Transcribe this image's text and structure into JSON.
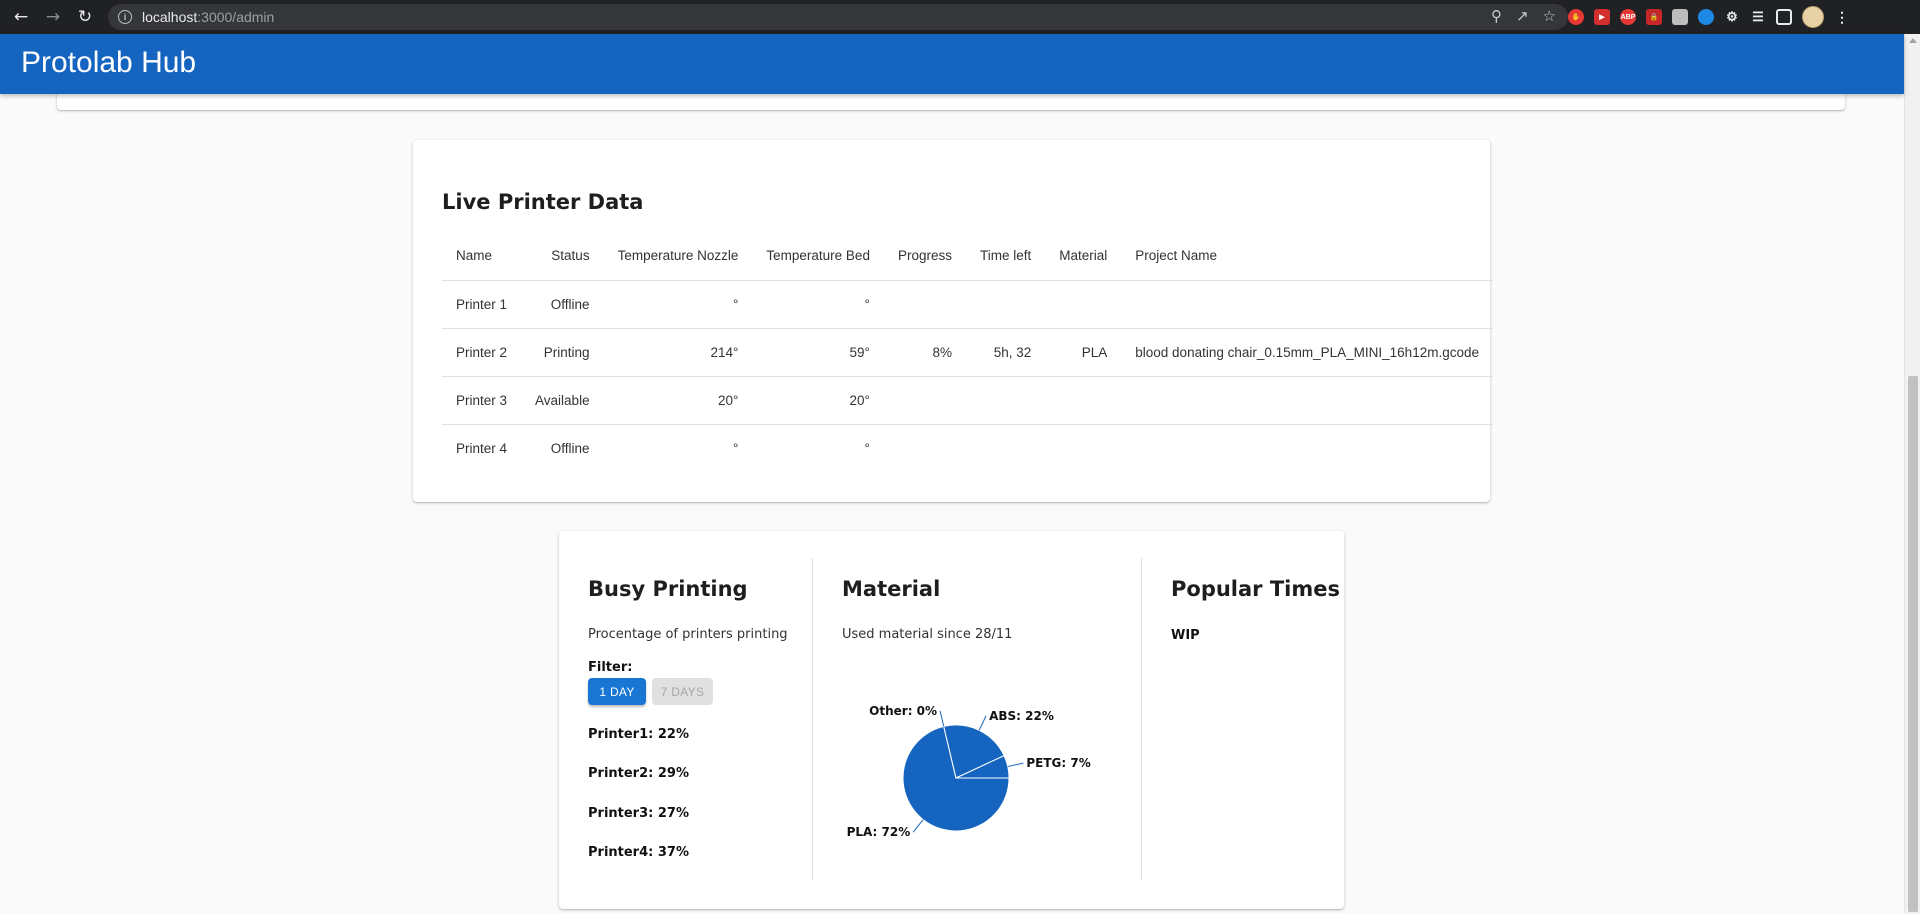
{
  "browser": {
    "url_host": "localhost",
    "url_rest": ":3000/admin"
  },
  "app": {
    "title": "Protolab Hub"
  },
  "live": {
    "title": "Live Printer Data",
    "columns": [
      "Name",
      "Status",
      "Temperature Nozzle",
      "Temperature Bed",
      "Progress",
      "Time left",
      "Material",
      "Project Name"
    ],
    "rows": [
      {
        "name": "Printer 1",
        "status": "Offline",
        "nozzle": "°",
        "bed": "°",
        "progress": "",
        "time_left": "",
        "material": "",
        "project": ""
      },
      {
        "name": "Printer 2",
        "status": "Printing",
        "nozzle": "214°",
        "bed": "59°",
        "progress": "8%",
        "time_left": "5h, 32",
        "material": "PLA",
        "project": "blood donating chair_0.15mm_PLA_MINI_16h12m.gcode"
      },
      {
        "name": "Printer 3",
        "status": "Available",
        "nozzle": "20°",
        "bed": "20°",
        "progress": "",
        "time_left": "",
        "material": "",
        "project": ""
      },
      {
        "name": "Printer 4",
        "status": "Offline",
        "nozzle": "°",
        "bed": "°",
        "progress": "",
        "time_left": "",
        "material": "",
        "project": ""
      }
    ]
  },
  "busy": {
    "title": "Busy Printing",
    "subtitle": "Procentage of printers printing",
    "filter_label": "Filter:",
    "btn_1day": "1 DAY",
    "btn_7days": "7 DAYS",
    "stats": [
      "Printer1: 22%",
      "Printer2: 29%",
      "Printer3: 27%",
      "Printer4: 37%"
    ]
  },
  "material": {
    "title": "Material",
    "subtitle": "Used material since 28/11",
    "color": "#1565c0"
  },
  "popular": {
    "title": "Popular Times",
    "wip": "WIP"
  },
  "chart_data": {
    "type": "pie",
    "slices": [
      {
        "label": "PLA: 72%",
        "value": 72
      },
      {
        "label": "Other: 0%",
        "value": 0
      },
      {
        "label": "ABS: 22%",
        "value": 22
      },
      {
        "label": "PETG: 7%",
        "value": 7
      }
    ],
    "colors": [
      "#1565c0"
    ]
  }
}
